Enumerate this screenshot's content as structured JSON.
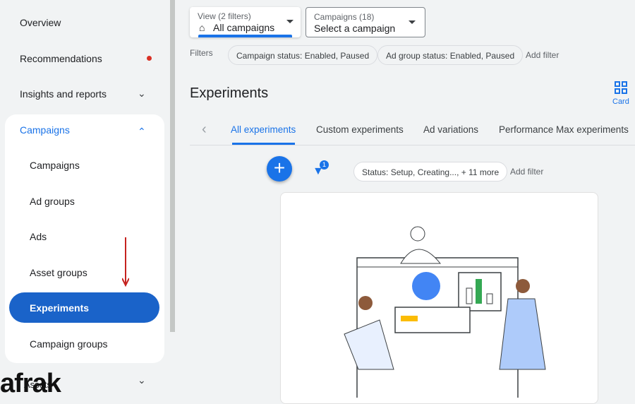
{
  "sidebar": {
    "overview": "Overview",
    "recommendations": "Recommendations",
    "insights": "Insights and reports",
    "campaigns_group": "Campaigns",
    "items": [
      "Campaigns",
      "Ad groups",
      "Ads",
      "Asset groups",
      "Experiments",
      "Campaign groups"
    ],
    "assets": "Assets"
  },
  "header": {
    "view_label": "View (2 filters)",
    "view_value": "All campaigns",
    "campaigns_label": "Campaigns (18)",
    "campaigns_value": "Select a campaign"
  },
  "filters": {
    "label": "Filters",
    "chips": [
      "Campaign status: Enabled, Paused",
      "Ad group status: Enabled, Paused"
    ],
    "add": "Add filter"
  },
  "page": {
    "title": "Experiments",
    "card_label": "Card"
  },
  "tabs": [
    "All experiments",
    "Custom experiments",
    "Ad variations",
    "Performance Max experiments"
  ],
  "toolbar": {
    "filter_count": "1",
    "status_chip": "Status: Setup, Creating..., + 11 more",
    "add_filter": "Add filter"
  },
  "watermark": "afrak",
  "colors": {
    "accent": "#1a73e8",
    "active": "#1a63c9",
    "arrow": "#c5221f"
  }
}
